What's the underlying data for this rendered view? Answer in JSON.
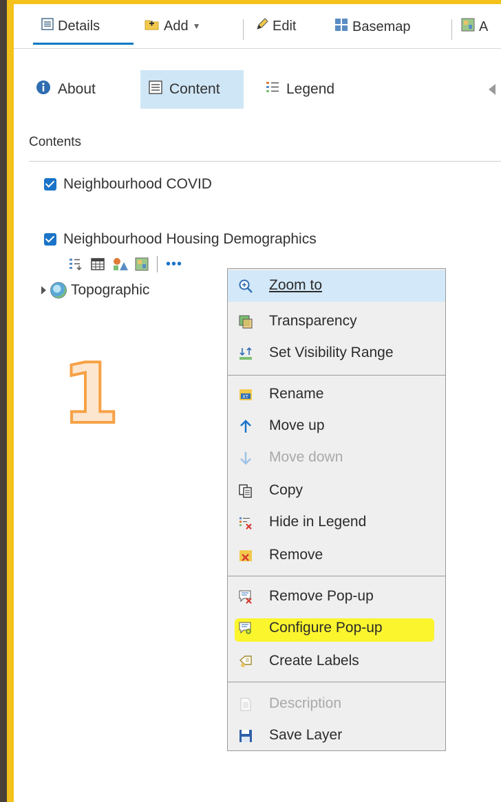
{
  "toolbar": {
    "details": "Details",
    "add": "Add",
    "edit": "Edit",
    "basemap": "Basemap",
    "analysis": "A"
  },
  "tabs": {
    "about": "About",
    "content": "Content",
    "legend": "Legend"
  },
  "contents_label": "Contents",
  "layers": [
    {
      "name": "Neighbourhood COVID",
      "checked": true
    },
    {
      "name": "Neighbourhood Housing Demographics",
      "checked": true
    }
  ],
  "basemap_layer": "Topographic",
  "step_number": "1",
  "more_options": "•••",
  "context_menu": {
    "zoom_to": "Zoom to",
    "transparency": "Transparency",
    "set_visibility_range": "Set Visibility Range",
    "rename": "Rename",
    "move_up": "Move up",
    "move_down": "Move down",
    "copy": "Copy",
    "hide_in_legend": "Hide in Legend",
    "remove": "Remove",
    "remove_popup": "Remove Pop-up",
    "configure_popup": "Configure Pop-up",
    "create_labels": "Create Labels",
    "description": "Description",
    "save_layer": "Save Layer"
  },
  "colors": {
    "accent": "#0079c1",
    "frame": "#f4c21a",
    "highlight": "#fbf52e",
    "step_number": "#f6a146"
  }
}
